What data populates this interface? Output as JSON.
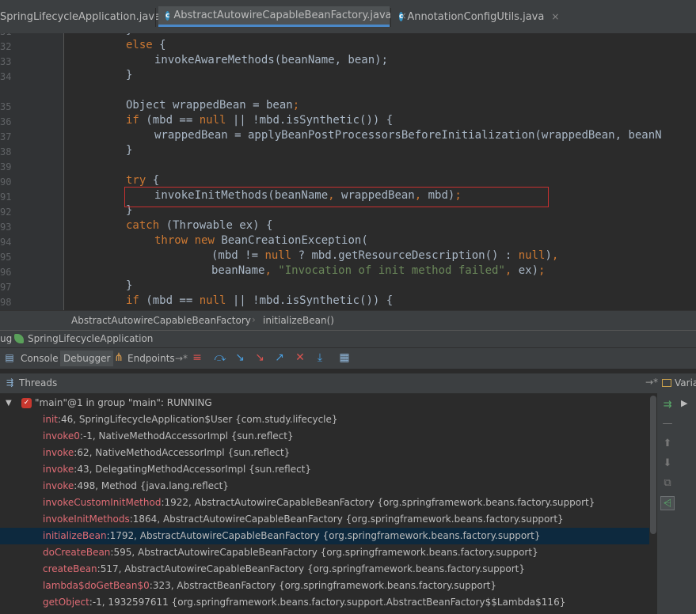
{
  "tabs": [
    {
      "label": "SpringLifecycleApplication.java",
      "close": "×",
      "active": false,
      "icon": ""
    },
    {
      "label": "AbstractAutowireCapableBeanFactory.java",
      "close": "×",
      "active": true,
      "icon": "c-class-icon"
    },
    {
      "label": "AnnotationConfigUtils.java",
      "close": "×",
      "active": false,
      "icon": "c-class-icon"
    }
  ],
  "gutter": {
    "line_numbers": [
      "31",
      "32",
      "33",
      "34",
      "35",
      "36",
      "37",
      "38",
      "39",
      "90",
      "91",
      "92",
      "93",
      "94",
      "95",
      "96",
      "97",
      "98",
      "99"
    ]
  },
  "code": {
    "l1": "}",
    "l2_kw": "else",
    "l2_rest": " {",
    "l3": "invokeAwareMethods(beanName, bean);",
    "l4": "}",
    "l6_a": "Object wrappedBean = bean",
    "l6_b": ";",
    "l7_kw": "if",
    "l7_a": " (mbd == ",
    "l7_null": "null",
    "l7_b": " || !mbd.isSynthetic()) {",
    "l8": "wrappedBean = applyBeanPostProcessorsBeforeInitialization(wrappedBean, beanN",
    "l9": "}",
    "l11_kw": "try",
    "l11_rest": " {",
    "l12_a": "invokeInitMethods(beanName",
    "l12_c1": ",",
    "l12_b": " wrappedBean",
    "l12_c2": ",",
    "l12_c": " mbd)",
    "l12_d": ";",
    "l13": "}",
    "l14_kw": "catch",
    "l14_rest": " (Throwable ex) {",
    "l15_kw1": "throw",
    "l15_kw2": "new",
    "l15_rest": " BeanCreationException(",
    "l16_a": "(mbd != ",
    "l16_null1": "null",
    "l16_b": " ? mbd.getResourceDescription() : ",
    "l16_null2": "null",
    "l16_c": ")",
    "l16_d": ",",
    "l17_a": "beanName",
    "l17_c1": ",",
    "l17_str": " \"Invocation of init method failed\"",
    "l17_c2": ",",
    "l17_b": " ex)",
    "l17_d": ";",
    "l18": "}",
    "l19_kw": "if",
    "l19_a": " (mbd == ",
    "l19_null": "null",
    "l19_b": " || !mbd.isSynthetic()) {"
  },
  "breadcrumb": {
    "class_name": "AbstractAutowireCapableBeanFactory",
    "separator": "›",
    "method": "initializeBean()"
  },
  "debug_window": {
    "title_prefix": "ug",
    "config_name": "SpringLifecycleApplication"
  },
  "toolbar": {
    "console": "Console",
    "debugger": "Debugger",
    "endpoints": "Endpoints",
    "endpoints_suffix": "→*"
  },
  "threads_panel": {
    "title": "Threads",
    "pin": "→*",
    "variables_label": "Varia"
  },
  "thread": {
    "label": "\"main\"@1 in group \"main\": RUNNING"
  },
  "frames": [
    {
      "method": "init",
      "rest": ":46, SpringLifecycleApplication$User {com.study.lifecycle}"
    },
    {
      "method": "invoke0",
      "rest": ":-1, NativeMethodAccessorImpl {sun.reflect}"
    },
    {
      "method": "invoke",
      "rest": ":62, NativeMethodAccessorImpl {sun.reflect}"
    },
    {
      "method": "invoke",
      "rest": ":43, DelegatingMethodAccessorImpl {sun.reflect}"
    },
    {
      "method": "invoke",
      "rest": ":498, Method {java.lang.reflect}"
    },
    {
      "method": "invokeCustomInitMethod",
      "rest": ":1922, AbstractAutowireCapableBeanFactory {org.springframework.beans.factory.support}"
    },
    {
      "method": "invokeInitMethods",
      "rest": ":1864, AbstractAutowireCapableBeanFactory {org.springframework.beans.factory.support}"
    },
    {
      "method": "initializeBean",
      "rest": ":1792, AbstractAutowireCapableBeanFactory {org.springframework.beans.factory.support}"
    },
    {
      "method": "doCreateBean",
      "rest": ":595, AbstractAutowireCapableBeanFactory {org.springframework.beans.factory.support}"
    },
    {
      "method": "createBean",
      "rest": ":517, AbstractAutowireCapableBeanFactory {org.springframework.beans.factory.support}"
    },
    {
      "method": "lambda$doGetBean$0",
      "rest": ":323, AbstractBeanFactory {org.springframework.beans.factory.support}"
    },
    {
      "method": "getObject",
      "rest": ":-1, 1932597611 {org.springframework.beans.factory.support.AbstractBeanFactory$$Lambda$116}"
    }
  ],
  "colors": {
    "accent_tab": "#4a88c7",
    "method_name": "#e06c75",
    "keyword": "#cc7832",
    "string": "#6a8759",
    "highlight_border": "#c83030",
    "selected_frame": "#0d293e"
  }
}
